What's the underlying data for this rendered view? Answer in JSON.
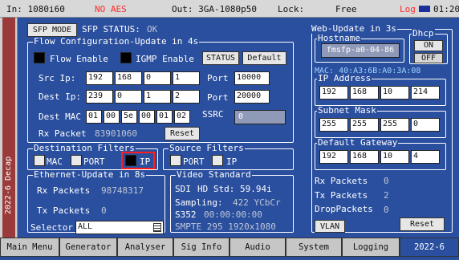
{
  "status_bar": {
    "input": "In: 1080i60",
    "aes": "NO AES",
    "output": "Out: 3GA-1080p50",
    "lock_label": "Lock:",
    "lock_value": "Free",
    "log_label": "Log",
    "time": "01:20"
  },
  "side_label": "2022-6 Decap",
  "sfp": {
    "mode_button": "SFP MODE",
    "status_label": "SFP STATUS:",
    "status_value": "OK"
  },
  "flow": {
    "legend": "Flow Configuration-Update in  4s",
    "flow_enable_label": "Flow Enable",
    "igmp_enable_label": "IGMP Enable",
    "status_button": "STATUS",
    "default_button": "Default",
    "src_ip_label": "Src Ip:",
    "src_ip": [
      "192",
      "168",
      "0",
      "1"
    ],
    "dest_ip_label": "Dest Ip:",
    "dest_ip": [
      "239",
      "0",
      "1",
      "2"
    ],
    "port_label": "Port",
    "src_port": "10000",
    "dest_port": "20000",
    "dest_mac_label": "Dest MAC",
    "dest_mac": [
      "01",
      "00",
      "5e",
      "00",
      "01",
      "02"
    ],
    "ssrc_label": "SSRC",
    "ssrc_value": "0",
    "rx_packet_label": "Rx Packet",
    "rx_packet_value": "83901060",
    "reset_button": "Reset"
  },
  "dest_filters": {
    "legend": "Destination Filters",
    "mac": "MAC",
    "port": "PORT",
    "ip": "IP"
  },
  "src_filters": {
    "legend": "Source Filters",
    "port": "PORT",
    "ip": "IP"
  },
  "ethernet": {
    "legend": "Ethernet-Update in  8s",
    "rx_label": "Rx Packets",
    "rx_value": "98748317",
    "tx_label": "Tx Packets",
    "tx_value": "0",
    "selector_label": "Selector",
    "selector_value": "ALL"
  },
  "video": {
    "legend": "Video Standard",
    "sdi_label": "SDI",
    "sdi_value": "HD Std: 59.94i",
    "sampling_label": "Sampling:",
    "sampling_value": "422 YCbCr",
    "s352_label": "S352",
    "s352_value": "00:00:00:00",
    "smpte": "SMPTE 295 1920x1080"
  },
  "web": {
    "legend": "Web-Update in  3s",
    "hostname_legend": "Hostname",
    "hostname": "fmsfp-a0-04-86",
    "dhcp_legend": "Dhcp",
    "dhcp_on": "ON",
    "dhcp_off": "OFF",
    "mac": "MAC: 40:A3:6B:A0:3A:08",
    "ip_legend": "IP Address",
    "ip": [
      "192",
      "168",
      "10",
      "214"
    ],
    "subnet_legend": "Subnet Mask",
    "subnet": [
      "255",
      "255",
      "255",
      "0"
    ],
    "gateway_legend": "Default Gateway",
    "gateway": [
      "192",
      "168",
      "10",
      "4"
    ],
    "rx_label": "Rx Packets",
    "rx_value": "0",
    "tx_label": "Tx Packets",
    "tx_value": "2",
    "drop_label": "DropPackets",
    "drop_value": "0",
    "vlan_button": "VLAN",
    "reset_button": "Reset"
  },
  "tabs": [
    "Main Menu",
    "Generator",
    "Analyser",
    "Sig Info",
    "Audio",
    "System",
    "Logging",
    "2022-6"
  ],
  "colors": {
    "background": "#2a4f9e",
    "alert_red": "#ff2a2a",
    "side_panel": "#9a3a3a",
    "highlight_box": "#ff1e1e"
  }
}
